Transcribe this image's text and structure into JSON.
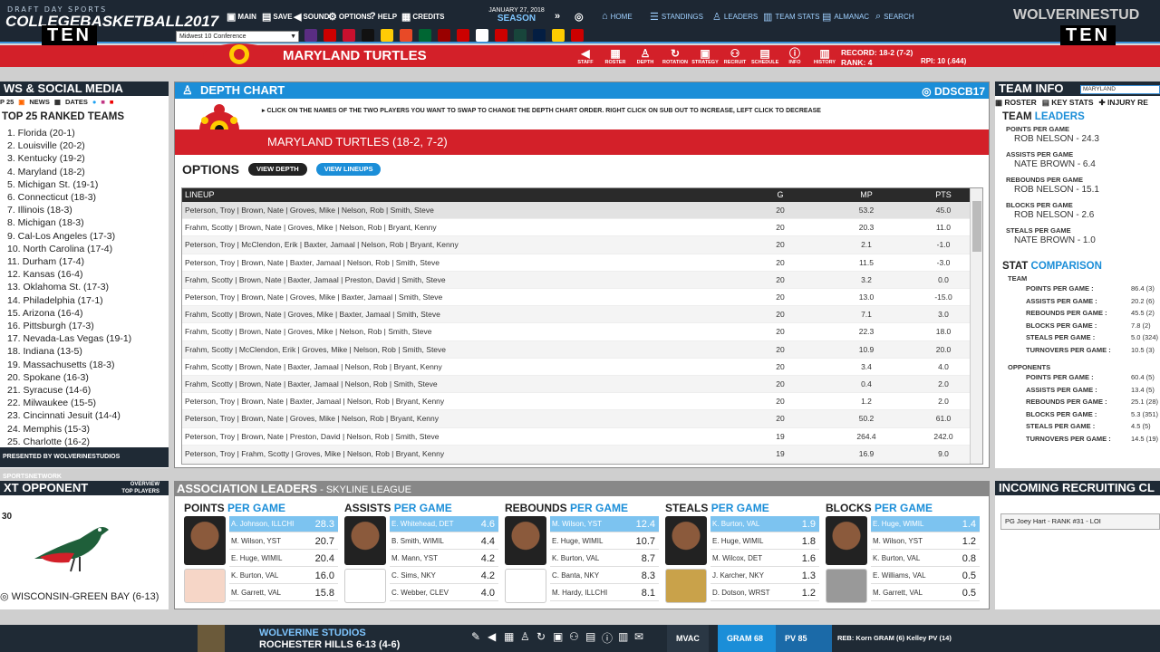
{
  "topbar": {
    "brand_small": "DRAFT DAY SPORTS",
    "brand_big": "COLLEGEBASKETBALL2017",
    "ten_left": "TEN",
    "ten_right": "TEN",
    "menu": [
      {
        "label": "MAIN",
        "icon": "monitor-icon"
      },
      {
        "label": "SAVE",
        "icon": "floppy-icon"
      },
      {
        "label": "SOUND",
        "icon": "speaker-icon"
      },
      {
        "label": "OPTIONS",
        "icon": "gear-icon"
      },
      {
        "label": "HELP",
        "icon": "help-icon"
      },
      {
        "label": "CREDITS",
        "icon": "credits-icon"
      }
    ],
    "date": "JANUARY 27, 2018",
    "season_label": "SEASON",
    "nav": [
      {
        "label": "HOME",
        "icon": "home-icon"
      },
      {
        "label": "STANDINGS",
        "icon": "standings-icon"
      },
      {
        "label": "LEADERS",
        "icon": "leaders-icon"
      },
      {
        "label": "TEAM STATS",
        "icon": "chart-icon"
      },
      {
        "label": "ALMANAC",
        "icon": "book-icon"
      },
      {
        "label": "SEARCH",
        "icon": "search-icon"
      }
    ],
    "studio": "WOLVERINESTUD"
  },
  "conference_select": "Midwest 10 Conference",
  "team_logo_colors": [
    "#5a2d82",
    "#cc0000",
    "#c8102e",
    "#111111",
    "#ffcb05",
    "#e84a27",
    "#006633",
    "#990000",
    "#cc0000",
    "#ffffff",
    "#cc0000",
    "#18453b",
    "#041e42",
    "#ffcc00",
    "#cc0000"
  ],
  "redbar": {
    "team_name": "MARYLAND TURTLES",
    "actions": [
      {
        "label": "STAFF",
        "icon": "whistle-icon"
      },
      {
        "label": "ROSTER",
        "icon": "roster-icon"
      },
      {
        "label": "DEPTH",
        "icon": "depth-icon"
      },
      {
        "label": "ROTATION",
        "icon": "rotation-icon"
      },
      {
        "label": "STRATEGY",
        "icon": "strategy-icon"
      },
      {
        "label": "RECRUIT",
        "icon": "recruit-icon"
      },
      {
        "label": "SCHEDULE",
        "icon": "schedule-icon"
      },
      {
        "label": "INFO",
        "icon": "info-icon"
      },
      {
        "label": "HISTORY",
        "icon": "history-icon"
      }
    ],
    "record": "RECORD: 18-2 (7-2)",
    "rank": "RANK: 4",
    "rpi": "RPI: 10 (.644)"
  },
  "news": {
    "title": "WS & SOCIAL MEDIA",
    "tabs": [
      "P 25",
      "NEWS",
      "DATES"
    ],
    "top25_title": "TOP 25 RANKED TEAMS",
    "teams": [
      "1. Florida (20-1)",
      "2. Louisville (20-2)",
      "3. Kentucky (19-2)",
      "4. Maryland (18-2)",
      "5. Michigan St. (19-1)",
      "6. Connecticut (18-3)",
      "7. Illinois (18-3)",
      "8. Michigan (18-3)",
      "9. Cal-Los Angeles (17-3)",
      "10. North Carolina (17-4)",
      "11. Durham (17-4)",
      "12. Kansas (16-4)",
      "13. Oklahoma St. (17-3)",
      "14. Philadelphia (17-1)",
      "15. Arizona (16-4)",
      "16. Pittsburgh (17-3)",
      "17. Nevada-Las Vegas (19-1)",
      "18. Indiana (13-5)",
      "19. Massachusetts (18-3)",
      "20. Spokane (16-3)",
      "21. Syracuse (14-6)",
      "22. Milwaukee (15-5)",
      "23. Cincinnati Jesuit (14-4)",
      "24. Memphis (15-3)",
      "25. Charlotte (16-2)"
    ],
    "presented_by": "PRESENTED BY WOLVERINESTUDIOS SPORTSNETWORK"
  },
  "depth": {
    "title": "DEPTH CHART",
    "badge": "DDSCB17",
    "instructions": "CLICK ON THE NAMES OF THE TWO PLAYERS YOU WANT TO SWAP TO CHANGE THE DEPTH CHART ORDER. RIGHT CLICK ON SUB OUT TO INCREASE, LEFT CLICK TO DECREASE",
    "team_strip": "MARYLAND TURTLES (18-2, 7-2)",
    "options_label": "OPTIONS",
    "view_depth": "VIEW DEPTH",
    "view_lineups": "VIEW LINEUPS",
    "columns": [
      "LINEUP",
      "G",
      "MP",
      "PTS"
    ],
    "rows": [
      {
        "lineup": "Peterson, Troy  |  Brown, Nate  |  Groves, Mike  |  Nelson, Rob  |  Smith, Steve",
        "g": "20",
        "mp": "53.2",
        "pts": "45.0"
      },
      {
        "lineup": "Frahm, Scotty  |  Brown, Nate  |  Groves, Mike  |  Nelson, Rob  |  Bryant, Kenny",
        "g": "20",
        "mp": "20.3",
        "pts": "11.0"
      },
      {
        "lineup": "Peterson, Troy  |  McClendon, Erik  |  Baxter, Jamaal  |  Nelson, Rob  |  Bryant, Kenny",
        "g": "20",
        "mp": "2.1",
        "pts": "-1.0"
      },
      {
        "lineup": "Peterson, Troy  |  Brown, Nate  |  Baxter, Jamaal  |  Nelson, Rob  |  Smith, Steve",
        "g": "20",
        "mp": "11.5",
        "pts": "-3.0"
      },
      {
        "lineup": "Frahm, Scotty  |  Brown, Nate  |  Baxter, Jamaal  |  Preston, David  |  Smith, Steve",
        "g": "20",
        "mp": "3.2",
        "pts": "0.0"
      },
      {
        "lineup": "Peterson, Troy  |  Brown, Nate  |  Groves, Mike  |  Baxter, Jamaal  |  Smith, Steve",
        "g": "20",
        "mp": "13.0",
        "pts": "-15.0"
      },
      {
        "lineup": "Frahm, Scotty  |  Brown, Nate  |  Groves, Mike  |  Baxter, Jamaal  |  Smith, Steve",
        "g": "20",
        "mp": "7.1",
        "pts": "3.0"
      },
      {
        "lineup": "Frahm, Scotty  |  Brown, Nate  |  Groves, Mike  |  Nelson, Rob  |  Smith, Steve",
        "g": "20",
        "mp": "22.3",
        "pts": "18.0"
      },
      {
        "lineup": "Frahm, Scotty  |  McClendon, Erik  |  Groves, Mike  |  Nelson, Rob  |  Smith, Steve",
        "g": "20",
        "mp": "10.9",
        "pts": "20.0"
      },
      {
        "lineup": "Frahm, Scotty  |  Brown, Nate  |  Baxter, Jamaal  |  Nelson, Rob  |  Bryant, Kenny",
        "g": "20",
        "mp": "3.4",
        "pts": "4.0"
      },
      {
        "lineup": "Frahm, Scotty  |  Brown, Nate  |  Baxter, Jamaal  |  Nelson, Rob  |  Smith, Steve",
        "g": "20",
        "mp": "0.4",
        "pts": "2.0"
      },
      {
        "lineup": "Peterson, Troy  |  Brown, Nate  |  Baxter, Jamaal  |  Nelson, Rob  |  Bryant, Kenny",
        "g": "20",
        "mp": "1.2",
        "pts": "2.0"
      },
      {
        "lineup": "Peterson, Troy  |  Brown, Nate  |  Groves, Mike  |  Nelson, Rob  |  Bryant, Kenny",
        "g": "20",
        "mp": "50.2",
        "pts": "61.0"
      },
      {
        "lineup": "Peterson, Troy  |  Brown, Nate  |  Preston, David  |  Nelson, Rob  |  Smith, Steve",
        "g": "19",
        "mp": "264.4",
        "pts": "242.0"
      },
      {
        "lineup": "Peterson, Troy  |  Frahm, Scotty  |  Groves, Mike  |  Nelson, Rob  |  Bryant, Kenny",
        "g": "19",
        "mp": "16.9",
        "pts": "9.0"
      }
    ]
  },
  "teaminfo": {
    "title": "TEAM INFO",
    "search_value": "MARYLAND",
    "tabs": [
      "ROSTER",
      "KEY STATS",
      "INJURY RE"
    ],
    "leaders_title_a": "TEAM",
    "leaders_title_b": "LEADERS",
    "leaders": [
      {
        "head": "POINTS PER GAME",
        "val": "ROB NELSON - 24.3"
      },
      {
        "head": "ASSISTS PER GAME",
        "val": "NATE BROWN - 6.4"
      },
      {
        "head": "REBOUNDS PER GAME",
        "val": "ROB NELSON - 15.1"
      },
      {
        "head": "BLOCKS PER GAME",
        "val": "ROB NELSON - 2.6"
      },
      {
        "head": "STEALS PER GAME",
        "val": "NATE BROWN - 1.0"
      }
    ],
    "compare_a": "STAT",
    "compare_b": "COMPARISON",
    "team_label": "TEAM",
    "team_stats": [
      {
        "k": "POINTS PER GAME :",
        "v": "86.4 (3)"
      },
      {
        "k": "ASSISTS PER GAME :",
        "v": "20.2 (6)"
      },
      {
        "k": "REBOUNDS PER GAME :",
        "v": "45.5 (2)"
      },
      {
        "k": "BLOCKS PER GAME :",
        "v": "7.8 (2)"
      },
      {
        "k": "STEALS PER GAME :",
        "v": "5.0 (324)"
      },
      {
        "k": "TURNOVERS PER GAME :",
        "v": "10.5 (3)"
      }
    ],
    "opp_label": "OPPONENTS",
    "opp_stats": [
      {
        "k": "POINTS PER GAME :",
        "v": "60.4 (5)"
      },
      {
        "k": "ASSISTS PER GAME :",
        "v": "13.4 (5)"
      },
      {
        "k": "REBOUNDS PER GAME :",
        "v": "25.1 (28)"
      },
      {
        "k": "BLOCKS PER GAME :",
        "v": "5.3 (351)"
      },
      {
        "k": "STEALS PER GAME :",
        "v": "4.5 (5)"
      },
      {
        "k": "TURNOVERS PER GAME :",
        "v": "14.5 (19)"
      }
    ]
  },
  "opponent": {
    "title": "XT OPPONENT",
    "link1": "OVERVIEW",
    "link2": "TOP PLAYERS",
    "num": "30",
    "name": "WISCONSIN-GREEN BAY (6-13)"
  },
  "assoc": {
    "title": "ASSOCIATION LEADERS",
    "league": " - SKYLINE LEAGUE",
    "cols": [
      {
        "a": "POINTS",
        "b": "PER GAME",
        "rows": [
          {
            "n": "A. Johnson, ILLCHI",
            "v": "28.3"
          },
          {
            "n": "M. Wilson, YST",
            "v": "20.7"
          },
          {
            "n": "E. Huge, WIMIL",
            "v": "20.4"
          },
          {
            "n": "K. Burton, VAL",
            "v": "16.0"
          },
          {
            "n": "M. Garrett, VAL",
            "v": "15.8"
          }
        ]
      },
      {
        "a": "ASSISTS",
        "b": "PER GAME",
        "rows": [
          {
            "n": "E. Whitehead, DET",
            "v": "4.6"
          },
          {
            "n": "B. Smith, WIMIL",
            "v": "4.4"
          },
          {
            "n": "M. Mann, YST",
            "v": "4.2"
          },
          {
            "n": "C. Sims, NKY",
            "v": "4.2"
          },
          {
            "n": "C. Webber, CLEV",
            "v": "4.0"
          }
        ]
      },
      {
        "a": "REBOUNDS",
        "b": "PER GAME",
        "rows": [
          {
            "n": "M. Wilson, YST",
            "v": "12.4"
          },
          {
            "n": "E. Huge, WIMIL",
            "v": "10.7"
          },
          {
            "n": "K. Burton, VAL",
            "v": "8.7"
          },
          {
            "n": "C. Banta, NKY",
            "v": "8.3"
          },
          {
            "n": "M. Hardy, ILLCHI",
            "v": "8.1"
          }
        ]
      },
      {
        "a": "STEALS",
        "b": "PER GAME",
        "rows": [
          {
            "n": "K. Burton, VAL",
            "v": "1.9"
          },
          {
            "n": "E. Huge, WIMIL",
            "v": "1.8"
          },
          {
            "n": "M. Wilcox, DET",
            "v": "1.6"
          },
          {
            "n": "J. Karcher, NKY",
            "v": "1.3"
          },
          {
            "n": "D. Dotson, WRST",
            "v": "1.2"
          }
        ]
      },
      {
        "a": "BLOCKS",
        "b": "PER GAME",
        "rows": [
          {
            "n": "E. Huge, WIMIL",
            "v": "1.4"
          },
          {
            "n": "M. Wilson, YST",
            "v": "1.2"
          },
          {
            "n": "K. Burton, VAL",
            "v": "0.8"
          },
          {
            "n": "E. Williams, VAL",
            "v": "0.5"
          },
          {
            "n": "M. Garrett, VAL",
            "v": "0.5"
          }
        ]
      }
    ]
  },
  "recruit": {
    "title": "INCOMING RECRUITING CL",
    "item": "PG Joey Hart - RANK #31 - LOI"
  },
  "footer": {
    "studio": "WOLVERINE STUDIOS",
    "team": "ROCHESTER HILLS 6-13 (4-6)",
    "tab1": "MVAC",
    "tab2": "GRAM 68",
    "tab3": "PV 85",
    "reb": "REB: Korn GRAM (6)    Kelley PV (14)"
  },
  "colors": {
    "accent_blue": "#1b8ed8",
    "brand_red": "#d32029",
    "dark": "#1f2a35",
    "highlight": "#7cc3f0"
  }
}
